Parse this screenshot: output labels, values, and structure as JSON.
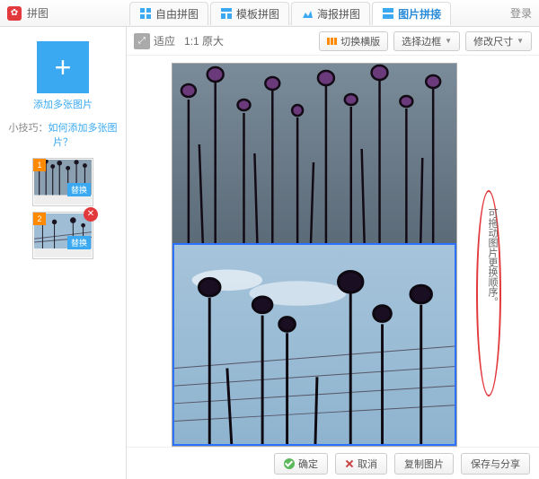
{
  "header": {
    "app_title": "拼图",
    "login": "登录",
    "tabs": [
      {
        "label": "自由拼图"
      },
      {
        "label": "模板拼图"
      },
      {
        "label": "海报拼图"
      },
      {
        "label": "图片拼接"
      }
    ]
  },
  "sidebar": {
    "add_label": "添加多张图片",
    "tip_prefix": "小技巧：",
    "tip_link": "如何添加多张图片？",
    "items": [
      {
        "index": "1",
        "replace": "替换"
      },
      {
        "index": "2",
        "replace": "替换"
      }
    ]
  },
  "toolbar": {
    "fit": "适应",
    "zoom": "1:1 原大",
    "switch_layout": "切换横版",
    "select_border": "选择边框",
    "resize": "修改尺寸"
  },
  "annotation": {
    "text": "可拖动图片更换顺序。"
  },
  "footer": {
    "ok": "确定",
    "cancel": "取消",
    "copy": "复制图片",
    "save": "保存与分享"
  }
}
